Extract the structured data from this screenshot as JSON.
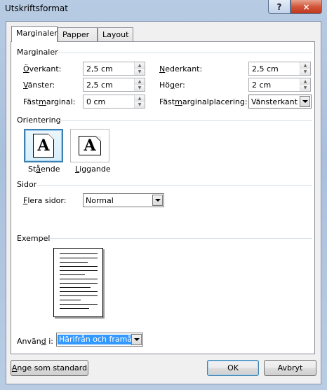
{
  "window": {
    "title": "Utskriftsformat",
    "help_label": "?",
    "close_label": "×"
  },
  "tabs": [
    {
      "label": "Marginaler",
      "active": true
    },
    {
      "label": "Papper",
      "active": false
    },
    {
      "label": "Layout",
      "active": false
    }
  ],
  "margins": {
    "title": "Marginaler",
    "top": {
      "label_u": "Ö",
      "label_rest": "verkant:",
      "value": "2,5 cm"
    },
    "bottom": {
      "label_u": "N",
      "label_rest": "ederkant:",
      "value": "2,5 cm"
    },
    "left": {
      "label_pre": "",
      "label_u": "V",
      "label_rest": "änster:",
      "value": "2,5 cm"
    },
    "right": {
      "label_pre": "Hö",
      "label_u": "g",
      "label_rest": "er:",
      "value": "2 cm"
    },
    "gutter": {
      "label_pre": "Fäst",
      "label_u": "m",
      "label_rest": "arginal:",
      "value": "0 cm"
    },
    "gutter_pos": {
      "label_pre": "Fäst",
      "label_u": "m",
      "label_rest": "arginalplacering:",
      "value": "Vänsterkant"
    }
  },
  "orientation": {
    "title": "Orientering",
    "portrait": {
      "label_pre": "St",
      "label_u": "å",
      "label_rest": "ende",
      "glyph": "A"
    },
    "landscape": {
      "label_pre": "",
      "label_u": "L",
      "label_rest": "iggande",
      "glyph": "A"
    }
  },
  "pages": {
    "title": "Sidor",
    "multiple": {
      "label_pre": "",
      "label_u": "F",
      "label_rest": "lera sidor:",
      "value": "Normal"
    }
  },
  "preview": {
    "title": "Exempel"
  },
  "apply": {
    "label_pre": "Använ",
    "label_u": "d",
    "label_rest": " i:",
    "value": "Härifrån och framåt"
  },
  "buttons": {
    "default": {
      "label_pre": "",
      "label_u": "A",
      "label_rest": "nge som standard"
    },
    "ok": "OK",
    "cancel": "Avbryt"
  }
}
